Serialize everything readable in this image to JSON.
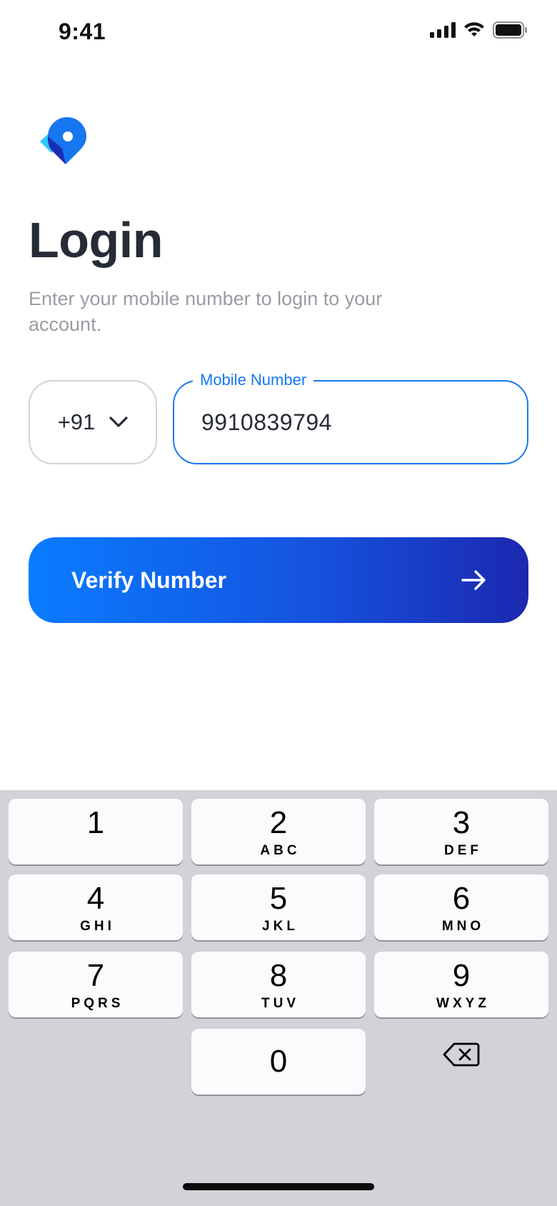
{
  "status_bar": {
    "time": "9:41",
    "icons": [
      "cellular-signal-icon",
      "wifi-icon",
      "battery-icon"
    ]
  },
  "app": {
    "logo_icon": "location-pin-logo",
    "brand_colors": {
      "primary": "#1677f0",
      "dark": "#1c28b0",
      "light": "#2fc8ff"
    }
  },
  "login": {
    "title": "Login",
    "subtitle": "Enter your mobile number to login to your account.",
    "country_code": {
      "value": "+91",
      "icon": "chevron-down-icon"
    },
    "mobile_field": {
      "label": "Mobile Number",
      "value": "9910839794"
    },
    "verify_button": {
      "label": "Verify Number",
      "icon": "arrow-right-icon"
    }
  },
  "keyboard": {
    "keys": [
      {
        "digit": "1",
        "letters": ""
      },
      {
        "digit": "2",
        "letters": "ABC"
      },
      {
        "digit": "3",
        "letters": "DEF"
      },
      {
        "digit": "4",
        "letters": "GHI"
      },
      {
        "digit": "5",
        "letters": "JKL"
      },
      {
        "digit": "6",
        "letters": "MNO"
      },
      {
        "digit": "7",
        "letters": "PQRS"
      },
      {
        "digit": "8",
        "letters": "TUV"
      },
      {
        "digit": "9",
        "letters": "WXYZ"
      },
      {
        "digit": "0",
        "letters": ""
      }
    ],
    "backspace_icon": "backspace-icon"
  }
}
